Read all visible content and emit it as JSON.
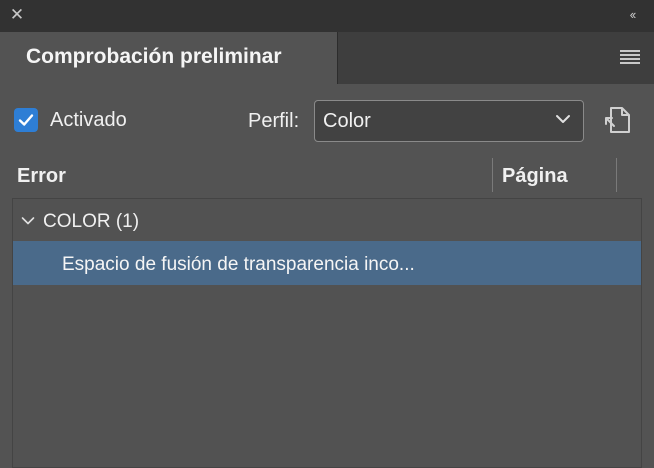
{
  "window": {
    "close_icon": "close-icon",
    "collapse_icon": "double-chevron-left-icon",
    "close_glyph": "✕",
    "collapse_glyph": "‹‹"
  },
  "tab": {
    "label": "Comprobación preliminar",
    "menu_icon": "panel-menu-icon"
  },
  "controls": {
    "enabled_label": "Activado",
    "enabled_checked": true,
    "profile_label": "Perfil:",
    "profile_value": "Color",
    "profile_icon": "profile-definition-icon"
  },
  "table": {
    "columns": [
      "Error",
      "Página"
    ],
    "groups": [
      {
        "label": "COLOR (1)",
        "expanded": true,
        "items": [
          {
            "error": "Espacio de fusión de transparencia inco...",
            "page": "",
            "selected": true
          }
        ]
      }
    ]
  },
  "colors": {
    "accent": "#2e7ed5",
    "selection": "#4a6a8a",
    "panel": "#535353",
    "titlebar": "#323232"
  }
}
